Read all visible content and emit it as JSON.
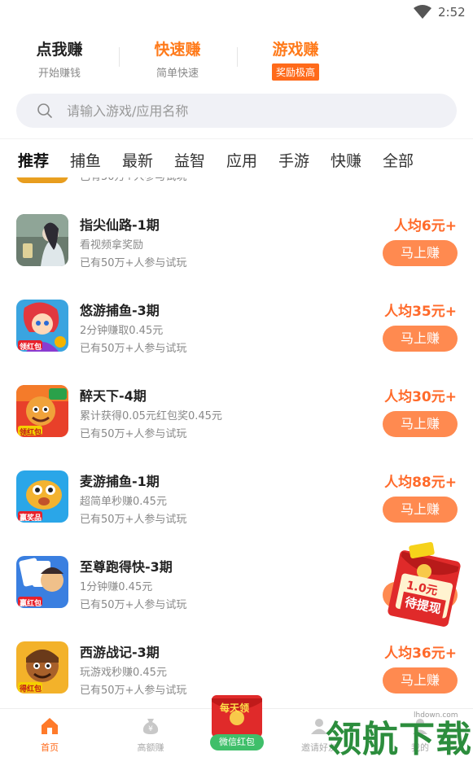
{
  "status_bar": {
    "time": "2:52"
  },
  "mode_tabs": [
    {
      "title": "点我赚",
      "subtitle": "开始赚钱"
    },
    {
      "title": "快速赚",
      "subtitle": "简单快速"
    },
    {
      "title": "游戏赚",
      "subtitle": "奖励极高"
    }
  ],
  "search": {
    "placeholder": "请输入游戏/应用名称"
  },
  "categories": [
    "推荐",
    "捕鱼",
    "最新",
    "益智",
    "应用",
    "手游",
    "快赚",
    "全部"
  ],
  "partial_row": {
    "join": "已有50万+人参与试玩"
  },
  "games": [
    {
      "name": "指尖仙路-1期",
      "desc": "看视频拿奖励",
      "join": "已有50万+人参与试玩",
      "reward": "人均6元+",
      "button": "马上赚"
    },
    {
      "name": "悠游捕鱼-3期",
      "desc": "2分钟赚取0.45元",
      "join": "已有50万+人参与试玩",
      "reward": "人均35元+",
      "button": "马上赚"
    },
    {
      "name": "醉天下-4期",
      "desc": "累计获得0.05元红包奖0.45元",
      "join": "已有50万+人参与试玩",
      "reward": "人均30元+",
      "button": "马上赚"
    },
    {
      "name": "麦游捕鱼-1期",
      "desc": "超简单秒赚0.45元",
      "join": "已有50万+人参与试玩",
      "reward": "人均88元+",
      "button": "马上赚"
    },
    {
      "name": "至尊跑得快-3期",
      "desc": "1分钟赚0.45元",
      "join": "已有50万+人参与试玩",
      "reward": "",
      "button": ""
    },
    {
      "name": "西游战记-3期",
      "desc": "玩游戏秒赚0.45元",
      "join": "已有50万+人参与试玩",
      "reward": "人均36元+",
      "button": "马上赚"
    }
  ],
  "thumb_labels": [
    "领红包",
    "领红包",
    "赢奖品",
    "赢红包",
    "得红包"
  ],
  "floating_envelope": {
    "amount": "1.0元",
    "label": "待提现"
  },
  "bottom_nav": {
    "items": [
      "首页",
      "高额赚",
      "邀请好友",
      "我的"
    ],
    "center": {
      "top": "每天领",
      "label": "微信红包"
    }
  },
  "watermark": {
    "text": "领航下载",
    "url": "lhdown.com"
  },
  "colors": {
    "accent": "#ff6a1a",
    "button": "#ff8a50",
    "reward": "#ff6a2a",
    "wechat_green": "#3fbf6a"
  }
}
